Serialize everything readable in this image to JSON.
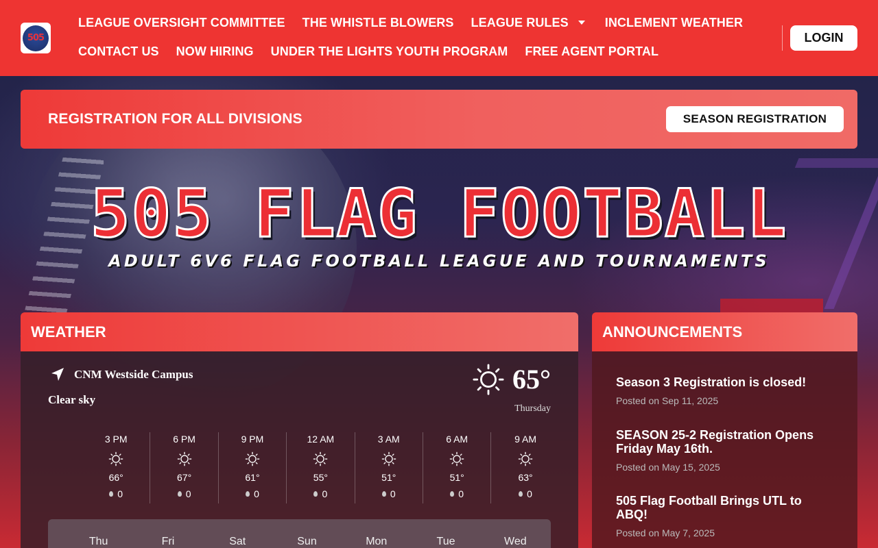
{
  "header": {
    "logo_text": "505",
    "nav_row1": [
      {
        "label": "LEAGUE OVERSIGHT COMMITTEE"
      },
      {
        "label": "THE WHISTLE BLOWERS"
      },
      {
        "label": "LEAGUE RULES",
        "dropdown": true
      },
      {
        "label": "INCLEMENT WEATHER"
      }
    ],
    "nav_row2": [
      {
        "label": "CONTACT US"
      },
      {
        "label": "NOW HIRING"
      },
      {
        "label": "UNDER THE LIGHTS YOUTH PROGRAM"
      },
      {
        "label": "FREE AGENT PORTAL"
      }
    ],
    "login_label": "LOGIN"
  },
  "registration": {
    "title": "REGISTRATION FOR ALL DIVISIONS",
    "button_label": "SEASON REGISTRATION"
  },
  "hero": {
    "title": "505 FLAG FOOTBALL",
    "subtitle": "ADULT 6V6 FLAG FOOTBALL LEAGUE AND TOURNAMENTS"
  },
  "weather": {
    "heading": "WEATHER",
    "location": "CNM Westside Campus",
    "description": "Clear sky",
    "current_temp": "65°",
    "day": "Thursday",
    "hours": [
      {
        "time": "3 PM",
        "temp": "66°",
        "rain": "0"
      },
      {
        "time": "6 PM",
        "temp": "67°",
        "rain": "0"
      },
      {
        "time": "9 PM",
        "temp": "61°",
        "rain": "0"
      },
      {
        "time": "12 AM",
        "temp": "55°",
        "rain": "0"
      },
      {
        "time": "3 AM",
        "temp": "51°",
        "rain": "0"
      },
      {
        "time": "6 AM",
        "temp": "51°",
        "rain": "0"
      },
      {
        "time": "9 AM",
        "temp": "63°",
        "rain": "0"
      }
    ],
    "days": [
      "Thu",
      "Fri",
      "Sat",
      "Sun",
      "Mon",
      "Tue",
      "Wed"
    ]
  },
  "announcements": {
    "heading": "ANNOUNCEMENTS",
    "items": [
      {
        "title": "Season 3 Registration is closed!",
        "date": "Posted on Sep 11, 2025"
      },
      {
        "title": "SEASON 25-2 Registration Opens Friday May 16th.",
        "date": "Posted on May 15, 2025"
      },
      {
        "title": "505 Flag Football Brings UTL to ABQ!",
        "date": "Posted on May 7, 2025"
      }
    ]
  },
  "colors": {
    "brand_red": "#ee3432",
    "panel_dark": "#321e28"
  }
}
